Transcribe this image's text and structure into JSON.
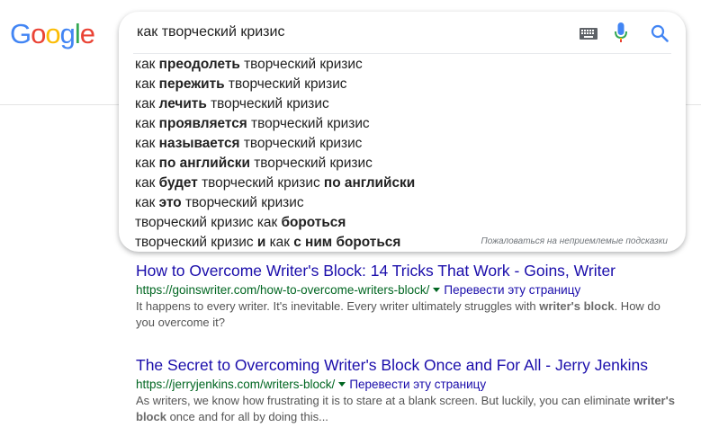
{
  "logo": {
    "letters": [
      {
        "ch": "G",
        "color": "#4285F4"
      },
      {
        "ch": "o",
        "color": "#EA4335"
      },
      {
        "ch": "o",
        "color": "#FBBC05"
      },
      {
        "ch": "g",
        "color": "#4285F4"
      },
      {
        "ch": "l",
        "color": "#34A853"
      },
      {
        "ch": "e",
        "color": "#EA4335"
      }
    ]
  },
  "search": {
    "query": "как творческий кризис"
  },
  "suggestions": [
    [
      {
        "t": "как ",
        "b": false
      },
      {
        "t": "преодолеть",
        "b": true
      },
      {
        "t": " творческий кризис",
        "b": false
      }
    ],
    [
      {
        "t": "как ",
        "b": false
      },
      {
        "t": "пережить",
        "b": true
      },
      {
        "t": " творческий кризис",
        "b": false
      }
    ],
    [
      {
        "t": "как ",
        "b": false
      },
      {
        "t": "лечить",
        "b": true
      },
      {
        "t": " творческий кризис",
        "b": false
      }
    ],
    [
      {
        "t": "как ",
        "b": false
      },
      {
        "t": "проявляется",
        "b": true
      },
      {
        "t": " творческий кризис",
        "b": false
      }
    ],
    [
      {
        "t": "как ",
        "b": false
      },
      {
        "t": "называется",
        "b": true
      },
      {
        "t": " творческий кризис",
        "b": false
      }
    ],
    [
      {
        "t": "как ",
        "b": false
      },
      {
        "t": "по английски",
        "b": true
      },
      {
        "t": " творческий кризис",
        "b": false
      }
    ],
    [
      {
        "t": "как ",
        "b": false
      },
      {
        "t": "будет",
        "b": true
      },
      {
        "t": " творческий кризис ",
        "b": false
      },
      {
        "t": "по английски",
        "b": true
      }
    ],
    [
      {
        "t": "как ",
        "b": false
      },
      {
        "t": "это",
        "b": true
      },
      {
        "t": " творческий кризис",
        "b": false
      }
    ],
    [
      {
        "t": "творческий кризис как ",
        "b": false
      },
      {
        "t": "бороться",
        "b": true
      }
    ],
    [
      {
        "t": "творческий кризис ",
        "b": false
      },
      {
        "t": "и",
        "b": true
      },
      {
        "t": " как ",
        "b": false
      },
      {
        "t": "с ним бороться",
        "b": true
      }
    ]
  ],
  "report_link": "Пожаловаться на неприемлемые подсказки",
  "results": [
    {
      "title": "How to Overcome Writer's Block: 14 Tricks That Work - Goins, Writer",
      "url": "https://goinswriter.com/how-to-overcome-writers-block/",
      "translate": "Перевести эту страницу",
      "snippet": [
        {
          "t": "It happens to every writer. It's inevitable. Every writer ultimately struggles with ",
          "b": false
        },
        {
          "t": "writer's block",
          "b": true
        },
        {
          "t": ". How do you overcome it?",
          "b": false
        }
      ]
    },
    {
      "title": "The Secret to Overcoming Writer's Block Once and For All - Jerry Jenkins",
      "url": "https://jerryjenkins.com/writers-block/",
      "translate": "Перевести эту страницу",
      "snippet": [
        {
          "t": "As writers, we know how frustrating it is to stare at a blank screen. But luckily, you can eliminate ",
          "b": false
        },
        {
          "t": "writer's block",
          "b": true
        },
        {
          "t": " once and for all by doing this...",
          "b": false
        }
      ]
    }
  ]
}
